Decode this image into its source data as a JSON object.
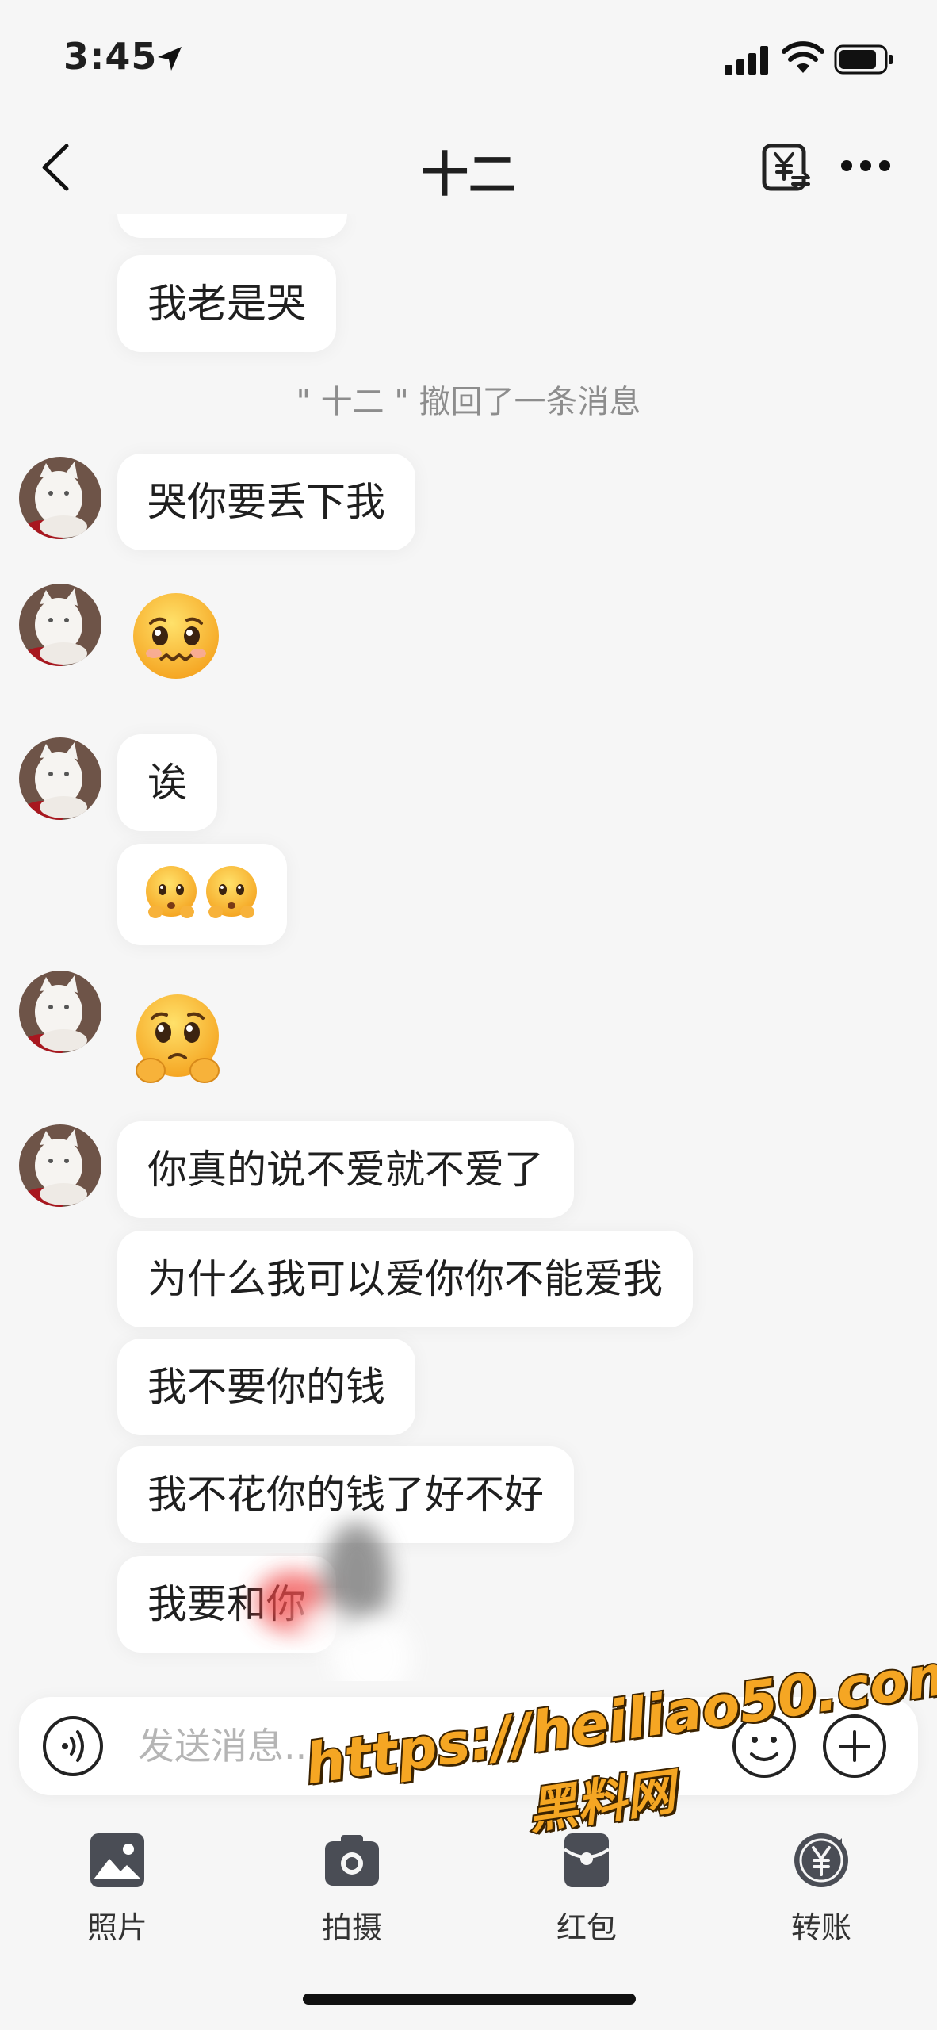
{
  "status_bar": {
    "time": "3:45",
    "icons": [
      "location-arrow-icon",
      "cellular-signal-icon",
      "wifi-icon",
      "battery-icon"
    ]
  },
  "nav": {
    "title": "十二",
    "back_icon": "chevron-left-icon",
    "transfer_icon": "yuan-transfer-icon",
    "more_icon": "ellipsis-icon"
  },
  "messages": {
    "top": "我老是哭",
    "recall_notice": "\" 十二 \" 撤回了一条消息",
    "m1": "哭你要丢下我",
    "m2_emoji": "pleading-face-emoji",
    "m3": "诶",
    "m4_emoji": "two-pleading-hands-emoji",
    "m5_emoji": "pleading-face-hands-emoji",
    "m6": "你真的说不爱就不爱了",
    "m7": "为什么我可以爱你你不能爱我",
    "m8": "我不要你的钱",
    "m9": "我不花你的钱了好不好",
    "m10": "我要和你"
  },
  "input": {
    "placeholder": "发送消息...",
    "value": "",
    "voice_icon": "voice-icon",
    "emoji_icon": "smile-icon",
    "plus_icon": "plus-circle-icon"
  },
  "toolbar": {
    "photo": "照片",
    "camera": "拍摄",
    "red_packet": "红包",
    "transfer": "转账"
  },
  "watermark": {
    "url": "https://heiliao50.com",
    "site": "黑料网"
  },
  "colors": {
    "background": "#f6f6f6",
    "bubble": "#ffffff",
    "watermark": "#f5a623"
  }
}
